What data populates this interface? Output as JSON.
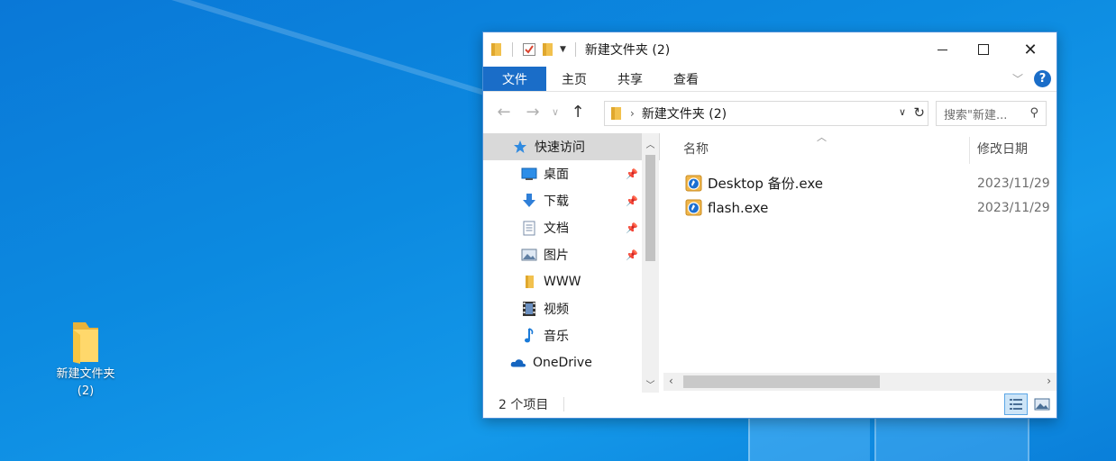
{
  "desktop": {
    "icon_label_line1": "新建文件夹",
    "icon_label_line2": "(2)"
  },
  "window": {
    "title": "新建文件夹 (2)",
    "controls": {
      "minimize": "",
      "maximize": "",
      "close": "✕"
    }
  },
  "ribbon": {
    "tabs": [
      "文件",
      "主页",
      "共享",
      "查看"
    ],
    "help": "?"
  },
  "address": {
    "path": "新建文件夹 (2)",
    "search_placeholder": "搜索\"新建..."
  },
  "sidebar": {
    "items": [
      {
        "label": "快速访问",
        "icon": "star-icon"
      },
      {
        "label": "桌面",
        "icon": "desktop-icon",
        "pinned": true
      },
      {
        "label": "下载",
        "icon": "download-icon",
        "pinned": true
      },
      {
        "label": "文档",
        "icon": "document-icon",
        "pinned": true
      },
      {
        "label": "图片",
        "icon": "pictures-icon",
        "pinned": true
      },
      {
        "label": "WWW",
        "icon": "folder-icon"
      },
      {
        "label": "视频",
        "icon": "video-icon"
      },
      {
        "label": "音乐",
        "icon": "music-icon"
      },
      {
        "label": "OneDrive",
        "icon": "cloud-icon"
      }
    ]
  },
  "filelist": {
    "columns": {
      "name": "名称",
      "date": "修改日期"
    },
    "files": [
      {
        "name": "Desktop 备份.exe",
        "date": "2023/11/29"
      },
      {
        "name": "flash.exe",
        "date": "2023/11/29"
      }
    ]
  },
  "status": {
    "count": "2 个项目"
  },
  "colors": {
    "accent": "#1a6dc8",
    "desktop": "#0c8ae0"
  }
}
